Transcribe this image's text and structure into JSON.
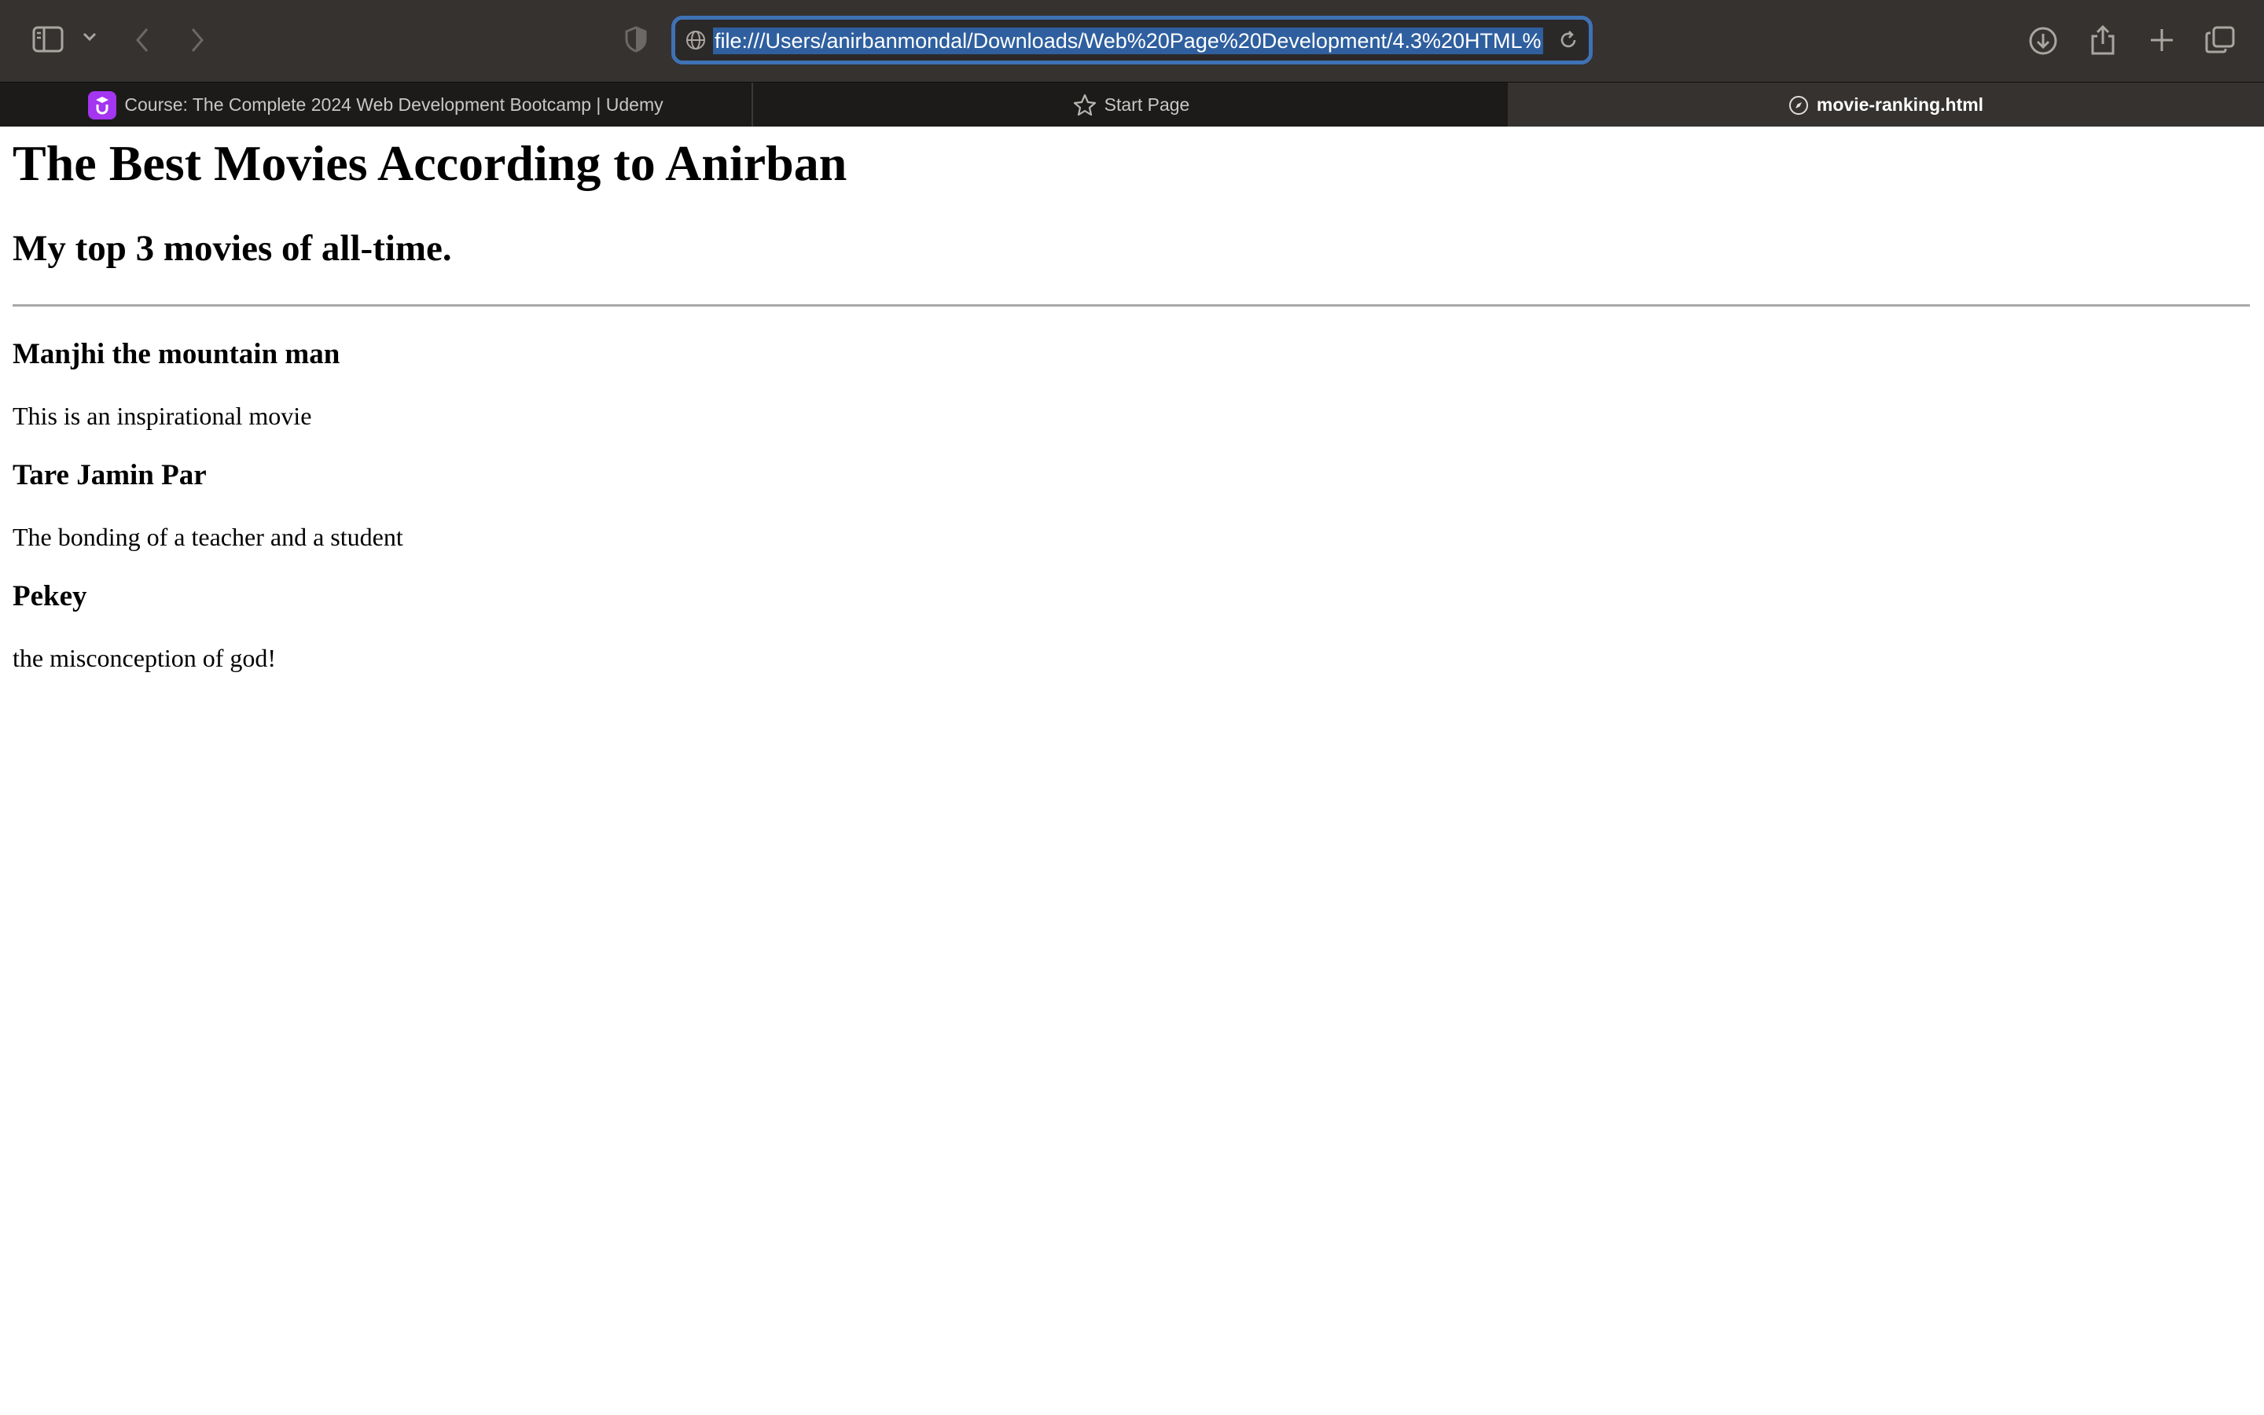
{
  "browser": {
    "address_url": "file:///Users/anirbanmondal/Downloads/Web%20Page%20Development/4.3%20HTML%",
    "accent_color": "#3f72b5",
    "icons": [
      "sidebar-icon",
      "chevron-down-icon",
      "back-arrow-icon",
      "forward-arrow-icon",
      "privacy-shield-icon",
      "globe-icon",
      "reload-icon",
      "download-icon",
      "share-icon",
      "new-tab-icon",
      "tab-overview-icon"
    ],
    "tabs": [
      {
        "label": "Course: The Complete 2024 Web Development Bootcamp | Udemy",
        "icon": "udemy-logo",
        "active": false
      },
      {
        "label": "Start Page",
        "icon": "star-icon",
        "active": false
      },
      {
        "label": "movie-ranking.html",
        "icon": "compass-icon",
        "active": true
      }
    ]
  },
  "page": {
    "title": "The Best Movies According to Anirban",
    "subtitle": "My top 3 movies of all-time.",
    "movies": [
      {
        "name": "Manjhi the mountain man",
        "description": "This is an inspirational movie"
      },
      {
        "name": "Tare Jamin Par",
        "description": "The bonding of a teacher and a student"
      },
      {
        "name": "Pekey",
        "description": "the misconception of god!"
      }
    ]
  }
}
